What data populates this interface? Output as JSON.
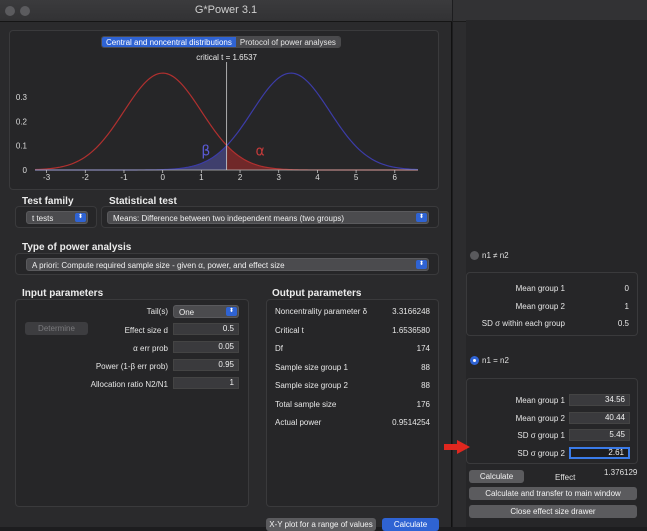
{
  "window": {
    "title": "G*Power 3.1"
  },
  "tabs": [
    {
      "label": "Central and noncentral distributions",
      "active": true
    },
    {
      "label": "Protocol of power analyses",
      "active": false
    }
  ],
  "plot": {
    "critical_label": "critical t = 1.6537",
    "y_ticks": [
      "0.3",
      "0.2",
      "0.1",
      "0"
    ],
    "x_ticks": [
      "-3",
      "-2",
      "-1",
      "0",
      "1",
      "2",
      "3",
      "4",
      "5",
      "6"
    ],
    "beta_label": "β",
    "alpha_label": "α",
    "colors": {
      "central": "#b0302f",
      "noncentral": "#3c3ca8",
      "beta_fill": "#4a4a8a",
      "alpha_fill": "#8a2a2a"
    }
  },
  "chart_data": {
    "type": "line",
    "title": "critical t = 1.6537",
    "xlabel": "",
    "ylabel": "",
    "xlim": [
      -3.3,
      6.6
    ],
    "ylim": [
      0,
      0.42
    ],
    "critical_t": 1.6537,
    "series": [
      {
        "type": "normal-curve",
        "mean": 0,
        "sd": 1,
        "color": "#b0302f"
      },
      {
        "type": "normal-curve",
        "mean": 3.3166248,
        "sd": 1,
        "color": "#3c3ca8"
      }
    ]
  },
  "test_family": {
    "title": "Test family",
    "value": "t tests"
  },
  "statistical_test": {
    "title": "Statistical test",
    "value": "Means: Difference between two independent means (two groups)"
  },
  "power_analysis": {
    "title": "Type of power analysis",
    "value": "A priori: Compute required sample size - given α, power, and effect size"
  },
  "input": {
    "title": "Input parameters",
    "determine_label": "Determine",
    "tails_label": "Tail(s)",
    "tails_value": "One",
    "rows": [
      {
        "label": "Effect size d",
        "value": "0.5"
      },
      {
        "label": "α err prob",
        "value": "0.05"
      },
      {
        "label": "Power (1-β err prob)",
        "value": "0.95"
      },
      {
        "label": "Allocation ratio N2/N1",
        "value": "1"
      }
    ]
  },
  "output": {
    "title": "Output parameters",
    "rows": [
      {
        "label": "Noncentrality parameter δ",
        "value": "3.3166248"
      },
      {
        "label": "Critical t",
        "value": "1.6536580"
      },
      {
        "label": "Df",
        "value": "174"
      },
      {
        "label": "Sample size group 1",
        "value": "88"
      },
      {
        "label": "Sample size group 2",
        "value": "88"
      },
      {
        "label": "Total sample size",
        "value": "176"
      },
      {
        "label": "Actual power",
        "value": "0.9514254"
      }
    ]
  },
  "bottom_buttons": {
    "xy_plot": "X-Y plot for a range of values",
    "calculate": "Calculate"
  },
  "effect_drawer": {
    "unequal_label": "n1 ≠ n2",
    "unequal_rows": [
      {
        "label": "Mean group 1",
        "value": "0"
      },
      {
        "label": "Mean group 2",
        "value": "1"
      },
      {
        "label": "SD σ within each group",
        "value": "0.5"
      }
    ],
    "equal_label": "n1 = n2",
    "equal_rows": [
      {
        "label": "Mean group 1",
        "value": "34.56"
      },
      {
        "label": "Mean group 2",
        "value": "40.44"
      },
      {
        "label": "SD σ group 1",
        "value": "5.45"
      },
      {
        "label": "SD σ group 2",
        "value": "2.61"
      }
    ],
    "calculate_label": "Calculate",
    "effect_label": "Effect",
    "effect_value": "1.376129",
    "transfer_label": "Calculate and transfer to main window",
    "close_label": "Close effect size drawer"
  }
}
